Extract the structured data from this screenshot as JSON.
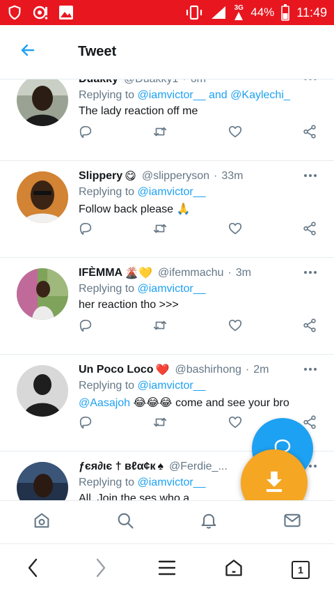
{
  "status_bar": {
    "network": "3G",
    "battery": "44%",
    "time": "11:49",
    "icons": [
      "shield-icon",
      "notification-icon",
      "image-icon",
      "vibrate-icon",
      "signal-icon",
      "battery-icon"
    ]
  },
  "header": {
    "title": "Tweet",
    "back_icon": "arrow-left-icon"
  },
  "tweets": [
    {
      "name": "Duakky",
      "emoji": "",
      "handle": "@Duakky1",
      "time": "6m",
      "replying_prefix": "Replying to",
      "replying_to": [
        "@iamvictor__",
        "@Kaylechi_"
      ],
      "text": "The lady reaction off me"
    },
    {
      "name": "Slippery",
      "emoji": "😋",
      "handle": "@slipperyson",
      "time": "33m",
      "replying_prefix": "Replying to",
      "replying_to": [
        "@iamvictor__"
      ],
      "text": "Follow back please 🙏"
    },
    {
      "name": "IFÈMMA",
      "emoji": "🌋💛",
      "handle": "@ifemmachu",
      "time": "3m",
      "replying_prefix": "Replying to",
      "replying_to": [
        "@iamvictor__"
      ],
      "text": "her reaction tho >>>"
    },
    {
      "name": "Un Poco Loco",
      "emoji": "❤️",
      "handle": "@bashirhong",
      "time": "2m",
      "replying_prefix": "Replying to",
      "replying_to": [
        "@iamvictor__"
      ],
      "text_mention": "@Aasajoh",
      "text_emoji": "😂😂😂",
      "text": "come and see your bro"
    },
    {
      "name": "ƒєя∂ιє † вℓα¢к",
      "emoji": "♠",
      "handle": "@Ferdie_...",
      "time": "",
      "replying_prefix": "Replying to",
      "replying_to": [
        "@iamvictor__"
      ],
      "text": "All. Join the ses who a..."
    }
  ],
  "actions": [
    "reply-icon",
    "retweet-icon",
    "like-icon",
    "share-icon"
  ],
  "tab_bar": [
    "home-icon",
    "search-icon",
    "notifications-icon",
    "messages-icon"
  ],
  "browser_nav": {
    "tab_count": "1"
  },
  "colors": {
    "status_bar": "#e8161f",
    "accent": "#1da1f2",
    "fab_download": "#f5a623",
    "secondary_text": "#657786"
  }
}
